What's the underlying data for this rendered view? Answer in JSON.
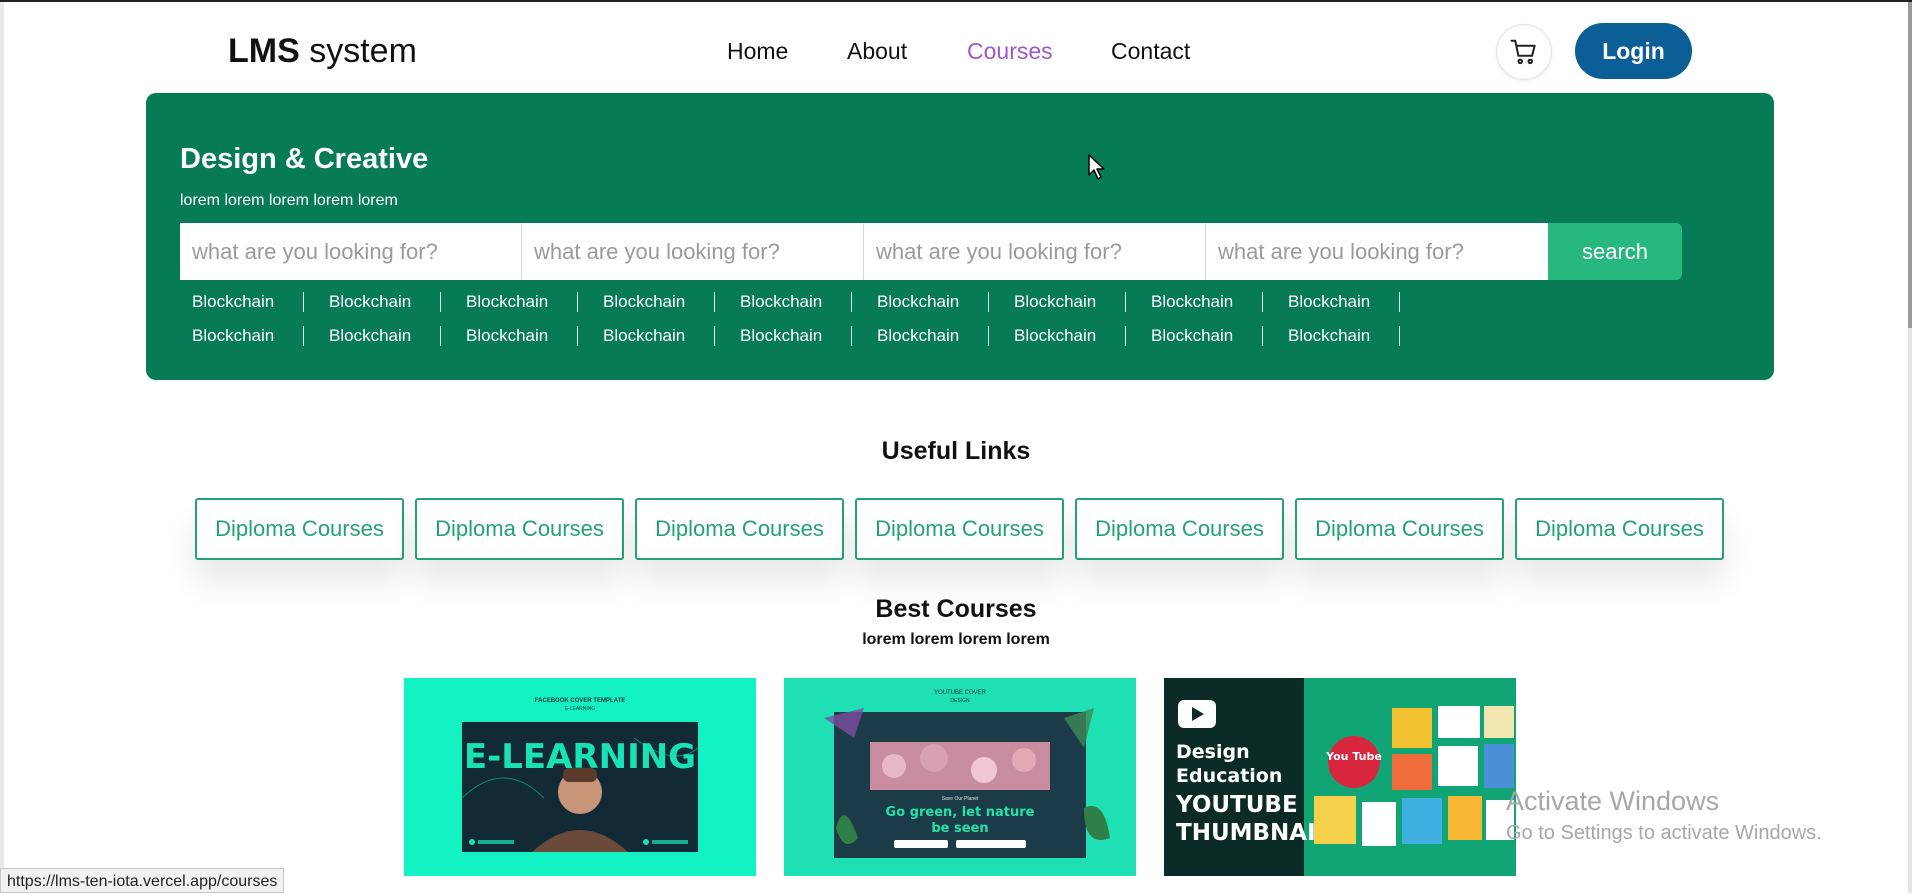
{
  "navbar": {
    "logo_bold": "LMS",
    "logo_rest": " system",
    "links": [
      "Home",
      "About",
      "Courses",
      "Contact"
    ],
    "active_link": "Courses",
    "active_color": "#9c59c9",
    "cart_icon": "cart-icon",
    "login_label": "Login",
    "login_color": "#0b5e96"
  },
  "hero": {
    "title": "Design & Creative",
    "subtitle": "lorem lorem lorem lorem lorem",
    "background": "#077b56",
    "search_placeholders": [
      "what are you looking for?",
      "what are you looking for?",
      "what are you looking for?",
      "what are you looking for?"
    ],
    "search_button": "search",
    "tags_row1": [
      "Blockchain",
      "Blockchain",
      "Blockchain",
      "Blockchain",
      "Blockchain",
      "Blockchain",
      "Blockchain",
      "Blockchain",
      "Blockchain"
    ],
    "tags_row2": [
      "Blockchain",
      "Blockchain",
      "Blockchain",
      "Blockchain",
      "Blockchain",
      "Blockchain",
      "Blockchain",
      "Blockchain",
      "Blockchain"
    ]
  },
  "useful_links": {
    "title": "Useful Links",
    "items": [
      "Diploma Courses",
      "Diploma Courses",
      "Diploma Courses",
      "Diploma Courses",
      "Diploma Courses",
      "Diploma Courses",
      "Diploma Courses"
    ],
    "accent": "#23a273"
  },
  "best_courses": {
    "title": "Best Courses",
    "subtitle": "lorem lorem lorem lorem",
    "cards": [
      {
        "small_text_1": "FACEBOOK COVER TEMPLATE",
        "small_text_2": "E-LEARNING",
        "headline": "E-LEARNING"
      },
      {
        "small_text_1": "YOUTUBE COVER",
        "small_text_2": "DESIGN",
        "tagline_1": "Save Our Planet",
        "headline_1": "Go green, let nature",
        "headline_2": "be seen"
      },
      {
        "line_1": "Design",
        "line_2": "Education",
        "line_3": "YOUTUBE",
        "line_4": "THUMBNAIL",
        "badge": "You Tube"
      }
    ]
  },
  "os_overlay": {
    "activate_title": "Activate Windows",
    "activate_sub": "Go to Settings to activate Windows."
  },
  "status_url": "https://lms-ten-iota.vercel.app/courses"
}
